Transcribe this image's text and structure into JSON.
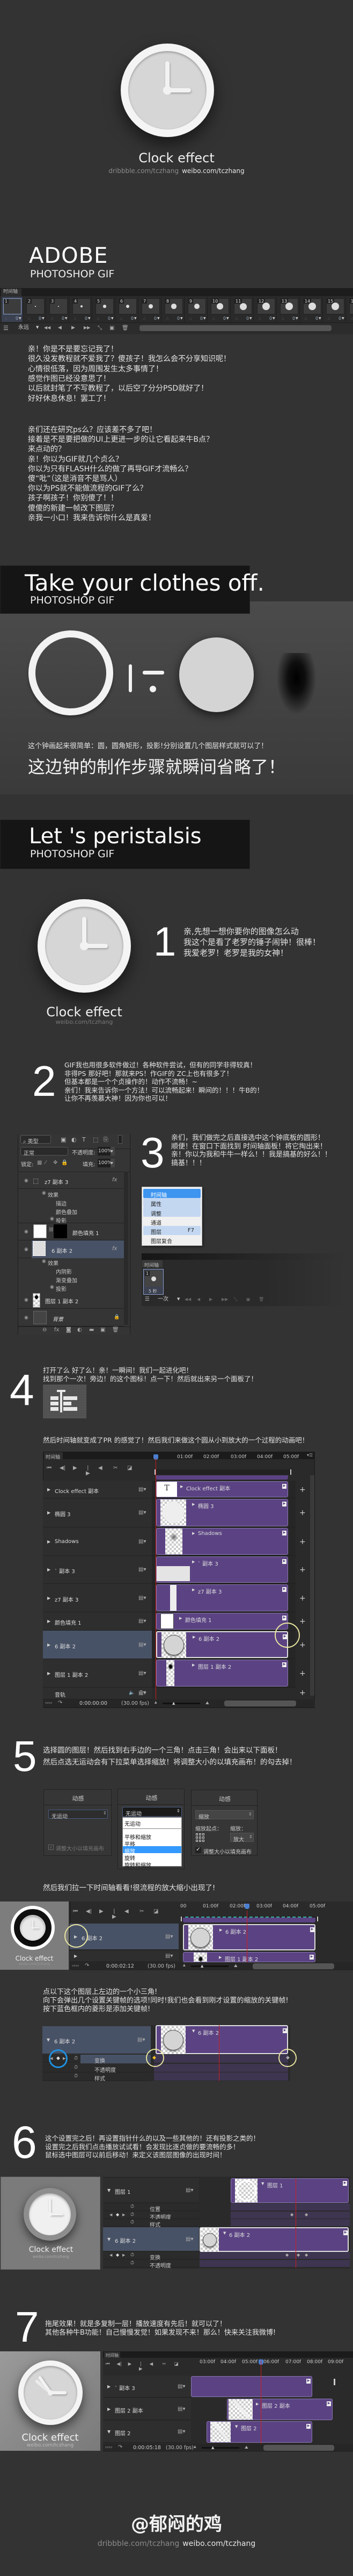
{
  "hero": {
    "title": "Clock effect",
    "dribbble": "dribbble.com/tczhang",
    "weibo": "weibo.com/tczhang"
  },
  "adobe": {
    "title": "ADOBE",
    "subtitle": "PHOTOSHOP GIF"
  },
  "frame_animation": {
    "tab": "时间轴",
    "frames": [
      "1",
      "2",
      "3",
      "4",
      "5",
      "6",
      "7",
      "8",
      "9",
      "10",
      "11",
      "12",
      "13",
      "14",
      "15",
      "16"
    ],
    "selected_frame": "1",
    "frame_delay": "0",
    "loop": "永远"
  },
  "intro": {
    "paragraph1": [
      "亲！你是不是要忘记我了！",
      "很久没发教程就不爱我了？傻孩子！我怎么会不分享知识呢！",
      "心情很低落，因为周围发生太多事情了！",
      "感觉作图已经没意思了！",
      "以后就封笔了不写教程了，以后空了分分PSD就好了！",
      "好好休息休息！罢工了！"
    ],
    "paragraph2": [
      "亲们还在研究ps么？应该差不多了吧！",
      "接着是不是要把做的UI上更进一步的让它看起来牛B点？",
      "来点动的？",
      "亲！你以为GIF就几个贞么？",
      "你以为只有FLASH什么的做了再导GIF才流畅么？",
      "傻“吡”（这是消音不是骂人）",
      "你以为PS就不能做流程的GIF了么？",
      "孩子啊孩子！你别傻了！！",
      "傻傻的新建一帧改下图层？",
      "亲我一小口！我来告诉你什么是真爱！"
    ]
  },
  "clothes": {
    "title": "Take your clothes off.",
    "subtitle": "PHOTOSHOP GIF",
    "caption": "这个钟画起来很简单：圆，圆角矩形，投影!分别设置几个图层样式就可以了！",
    "headline": "这边钟的制作步骤就瞬间省略了！"
  },
  "peristalsis": {
    "title": "Let 's peristalsis",
    "subtitle": "PHOTOSHOP GIF"
  },
  "card": {
    "title": "Clock effect",
    "link": "weibo.com/tczhang"
  },
  "step1": {
    "number": "1",
    "lines": [
      "亲,先想一想你要你的图像怎么动",
      "我这个是看了老罗的锤子闹钟！很棒！",
      "我爱老罗！老罗是我的女神！"
    ]
  },
  "step2": {
    "number": "2",
    "lines": [
      "GIF我也用很多软件做过！各种软件尝试，但有的同学非得较真！",
      "非得PS 那好吧！那就来PS！作GIF的 ZC上也有很多了！",
      "但基本都是一个个贞操作的！动作不流畅！~",
      "亲们！我来告诉你一个方法！可以流畅起来！瞬间的！！！牛B的！",
      "让你不再羡慕大神！因为你也可以！"
    ]
  },
  "step3": {
    "number": "3",
    "lines": [
      "亲们，我们做完之后直接选中这个钟底板的圆形！",
      "顺便！在窗口下面找到 时间轴面板！将它掏出来！",
      "亲！你以为我和牛牛一样么！！我是搞基的好么！！",
      "搞基！！！"
    ],
    "layers_panel": {
      "filter": "类型",
      "blend_mode": "正常",
      "opacity_label": "不透明度:",
      "opacity": "100%",
      "lock_label": "锁定:",
      "fill_label": "填充:",
      "fill": "100%",
      "layers": [
        {
          "name": "z7 副本 3",
          "effects_label": "效果",
          "effects": [
            "描边",
            "颜色叠加",
            "投影"
          ]
        },
        {
          "name": "颜色填充 1"
        },
        {
          "name": "6 副本 2",
          "selected": true,
          "effects_label": "效果",
          "effects": [
            "内阴影",
            "渐变叠加",
            "投影"
          ]
        },
        {
          "name": "图层 1 副本 2"
        },
        {
          "name": "背景",
          "locked": true
        }
      ],
      "fx": "fx"
    },
    "window_menu": {
      "items": [
        {
          "label": "时间轴",
          "state": "active"
        },
        {
          "label": "属性",
          "state": "hover"
        },
        {
          "label": "调整",
          "state": "hover"
        },
        {
          "label": "通道",
          "state": "normal"
        },
        {
          "label": "图层",
          "shortcut": "F7",
          "state": "hover"
        },
        {
          "label": "图层复合",
          "state": "normal"
        }
      ]
    },
    "timeline": {
      "tab": "时间轴",
      "frame": "1",
      "delay": "5 秒",
      "loop": "一次"
    }
  },
  "step4": {
    "number": "4",
    "lines": [
      "打开了么 好了么！亲！一瞬间！我们一起进化吧！",
      "找到那个一次！旁边！的这个图标！点一下！然后就出来另一个面板了！"
    ],
    "note": "然后时间轴就变成了PR 的感觉了！然后我们来做这个圆从小到放大的一个过程的动画吧！",
    "timeline": {
      "tab": "时间轴",
      "ruler": [
        "01:00f",
        "02:00f",
        "03:00f",
        "04:00f",
        "05:00f"
      ],
      "layers": [
        "Clock effect 副本",
        "椭圆 3",
        "Shadows",
        "` 副本 3",
        "z7 副本 3",
        "颜色填充 1",
        "6 副本 2",
        "图层 1 副本 2"
      ],
      "selected_layer": "6 副本 2",
      "audio": "音轨",
      "timecode": "0:00:00:00",
      "fps": "(30.00 fps)"
    }
  },
  "step5": {
    "number": "5",
    "lines": [
      "选择圆的图层！然后找到右手边的一个三角！点击三角！会出来以下面板！",
      "然后点选无运动会有下拉菜单选择缩放！将调整大小的以填充画布！的勾去掉！"
    ],
    "motion_panels": [
      {
        "header": "动感",
        "select": "无运动",
        "checkbox": "调整大小以填充画布",
        "checked": true,
        "disabled": true
      },
      {
        "header": "动感",
        "select": "无运动",
        "options": [
          "无运动",
          "平移和缩放",
          "平移",
          "缩放",
          "旋转",
          "旋转和缩放"
        ],
        "highlighted": "缩放"
      },
      {
        "header": "动感",
        "select": "缩放",
        "origin_label": "缩放起点：",
        "zoom_label": "缩放：",
        "zoom_select": "放大",
        "checkbox": "调整大小以填充画布",
        "checked": true
      }
    ],
    "note": "然后我们拉一下时间轴看看!很流程的放大缩小出现了!",
    "timeline": {
      "ruler": [
        "00",
        "01:00f",
        "02:00f",
        "03:00f",
        "04:00f",
        "05:00f"
      ],
      "layers": [
        "6 副本 2",
        "图层 1 副本 2"
      ],
      "timecode": "0:00:02:12",
      "fps": "(30.00 fps)"
    },
    "keyframe_note": [
      "点以下这个图层上左边的一个小三角!",
      "向下会弹出几个设置关键帧的选项!同时!我们也会看到刚才设置的缩放的关键帧!",
      "按下蓝色框内的菱形是添加关键帧!"
    ],
    "keyframe_panel": {
      "layer": "6 副本 2",
      "properties": [
        "变换",
        "不透明度",
        "样式"
      ]
    }
  },
  "step6": {
    "number": "6",
    "lines": [
      "这个设置完之后！再设置指针什么的以及一些其他的！还有投影之类的！",
      "设置完之后我们点击播放试试看！会发现比逐贞做的要流畅的多！",
      "鼠标选中图层可以前后移动！来定义该图层图像的出现时间！"
    ],
    "panel": {
      "layers": [
        {
          "name": "图层 1",
          "properties": [
            "位置",
            "不透明度",
            "样式"
          ]
        },
        {
          "name": "6 副本 2",
          "properties": [
            "变换",
            "不透明度"
          ]
        }
      ]
    }
  },
  "step7": {
    "number": "7",
    "lines": [
      "拖尾效果！就是多复制一层！播放速度有先后！就可以了！",
      "其他各种牛B功能！自己慢慢发觉！如果发现不来！那么！快来关注我微博!"
    ],
    "timeline": {
      "tab": "时间轴",
      "ruler": [
        "03:00f",
        "04:00f",
        "05:00f",
        "06:00f",
        "07:00f",
        "08:00f",
        "09:00f"
      ],
      "layers": [
        "` 副本 3",
        "图层 2 副本",
        "图层 2"
      ],
      "timecode": "0:00:05:18",
      "fps": "(30.00 fps)"
    }
  },
  "footer": {
    "author": "@郁闷的鸡",
    "dribbble": "dribbble.com/tczhang",
    "weibo": "weibo.com/tczhang"
  },
  "colors": {
    "background": "#333333",
    "banner": "#151515",
    "clip": "#5b4383",
    "selected_layer": "#485266",
    "menu_active": "#3d95f0",
    "playhead": "#d01c1c",
    "highlight_circle": "#e8e4a0",
    "keyframe_button_circle": "#1e90e0"
  }
}
